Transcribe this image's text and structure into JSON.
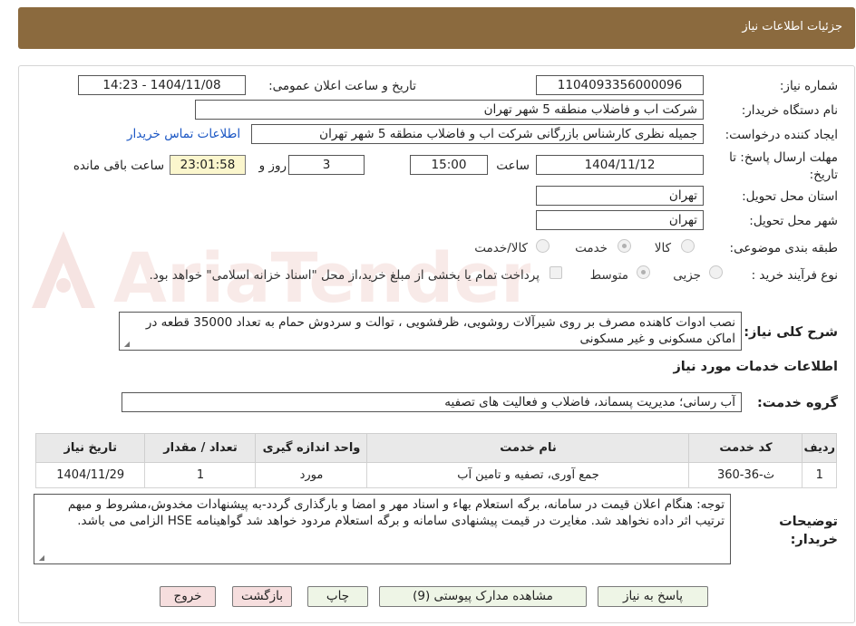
{
  "header": {
    "title": "جزئیات اطلاعات نیاز"
  },
  "fields": {
    "need_number_label": "شماره نیاز:",
    "need_number": "1104093356000096",
    "announce_label": "تاریخ و ساعت اعلان عمومی:",
    "announce_value": "1404/11/08 - 14:23",
    "buyer_org_label": "نام دستگاه خریدار:",
    "buyer_org": "شرکت اب و فاضلاب منطقه 5 شهر تهران",
    "requester_label": "ایجاد کننده درخواست:",
    "requester": "جمیله نظری کارشناس بازرگانی شرکت اب و فاضلاب منطقه 5 شهر تهران",
    "contact_link": "اطلاعات تماس خریدار",
    "deadline_label": "مهلت ارسال پاسخ: تا تاریخ:",
    "deadline_date": "1404/11/12",
    "time_label": "ساعت",
    "deadline_time": "15:00",
    "days": "3",
    "days_label": "روز و",
    "remaining": "23:01:58",
    "remaining_label": "ساعت باقی مانده",
    "province_label": "استان محل تحویل:",
    "province": "تهران",
    "city_label": "شهر محل تحویل:",
    "city": "تهران",
    "category_label": "طبقه بندی موضوعی:",
    "category_options": [
      "کالا",
      "خدمت",
      "کالا/خدمت"
    ],
    "category_selected": "خدمت",
    "process_label": "نوع فرآیند خرید :",
    "process_options": [
      "جزیی",
      "متوسط"
    ],
    "process_selected": "متوسط",
    "payment_note": "پرداخت تمام یا بخشی از مبلغ خرید،از محل \"اسناد خزانه اسلامی\" خواهد بود."
  },
  "description": {
    "label": "شرح کلی نیاز:",
    "text": "نصب ادوات کاهنده مصرف بر روی شیرآلات روشویی، ظرفشویی ، توالت و سردوش حمام به تعداد 35000 قطعه در اماکن مسکونی و غیر مسکونی"
  },
  "services": {
    "section_title": "اطلاعات خدمات مورد نیاز",
    "group_label": "گروه خدمت:",
    "group_value": "آب رسانی؛ مدیریت پسماند، فاضلاب و فعالیت های تصفیه",
    "columns": [
      "ردیف",
      "کد خدمت",
      "نام خدمت",
      "واحد اندازه گیری",
      "تعداد / مقدار",
      "تاریخ نیاز"
    ],
    "rows": [
      {
        "row": "1",
        "code": "ث-36-360",
        "name": "جمع آوری، تصفیه و تامین آب",
        "unit": "مورد",
        "qty": "1",
        "date": "1404/11/29"
      }
    ]
  },
  "buyer_notes": {
    "label": "توضیحات خریدار:",
    "text": "توجه: هنگام اعلان قیمت در سامانه، برگه استعلام بهاء و اسناد مهر و امضا و بارگذاری گردد-به پیشنهادات مخدوش،مشروط و مبهم ترتیب اثر داده نخواهد شد. مغایرت در قیمت پیشنهادی سامانه و برگه استعلام مردود خواهد شد گواهینامه HSE الزامی می باشد."
  },
  "buttons": {
    "respond": "پاسخ به نیاز",
    "attachments": "مشاهده مدارک پیوستی (9)",
    "print": "چاپ",
    "back": "بازگشت",
    "exit": "خروج"
  },
  "watermark": {
    "text": "AriaTender.neT"
  },
  "colors": {
    "header": "#8b6a3e",
    "link": "#1a56c4",
    "timer_bg": "#fbf6cd",
    "button_bg": "#eef5e6",
    "button_red_bg": "#f6dede"
  }
}
